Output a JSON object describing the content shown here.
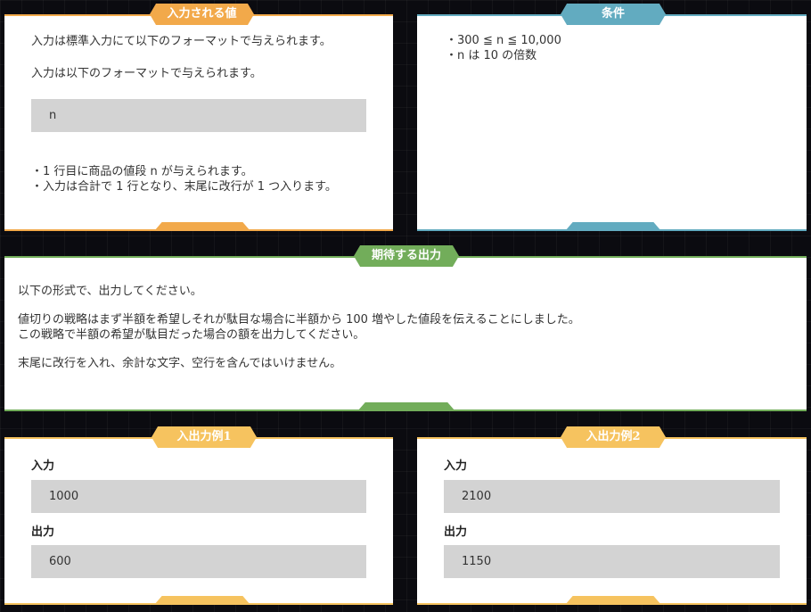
{
  "colors": {
    "input_format_accent": "#f2a94a",
    "constraints_accent": "#62abc0",
    "expected_output_accent": "#72ad5a",
    "examples_accent": "#f6c35f",
    "code_box_bg": "#d3d3d3",
    "page_bg": "#0b0b10"
  },
  "input_format": {
    "title": "入力される値",
    "line1": "入力は標準入力にて以下のフォーマットで与えられます。",
    "line2": "入力は以下のフォーマットで与えられます。",
    "format_code": "n",
    "bullet1": "・1 行目に商品の値段 n が与えられます。",
    "bullet2": "・入力は合計で 1 行となり、末尾に改行が 1 つ入ります。"
  },
  "constraints": {
    "title": "条件",
    "bullet1": "・300 ≦ n ≦ 10,000",
    "bullet2": "・n は 10 の倍数"
  },
  "expected_output": {
    "title": "期待する出力",
    "line1": "以下の形式で、出力してください。",
    "line2": "値切りの戦略はまず半額を希望しそれが駄目な場合に半額から 100 増やした値段を伝えることにしました。",
    "line3": "この戦略で半額の希望が駄目だった場合の額を出力してください。",
    "line4": "末尾に改行を入れ、余計な文字、空行を含んではいけません。"
  },
  "example1": {
    "title": "入出力例1",
    "input_label": "入力",
    "input_value": "1000",
    "output_label": "出力",
    "output_value": "600"
  },
  "example2": {
    "title": "入出力例2",
    "input_label": "入力",
    "input_value": "2100",
    "output_label": "出力",
    "output_value": "1150"
  }
}
